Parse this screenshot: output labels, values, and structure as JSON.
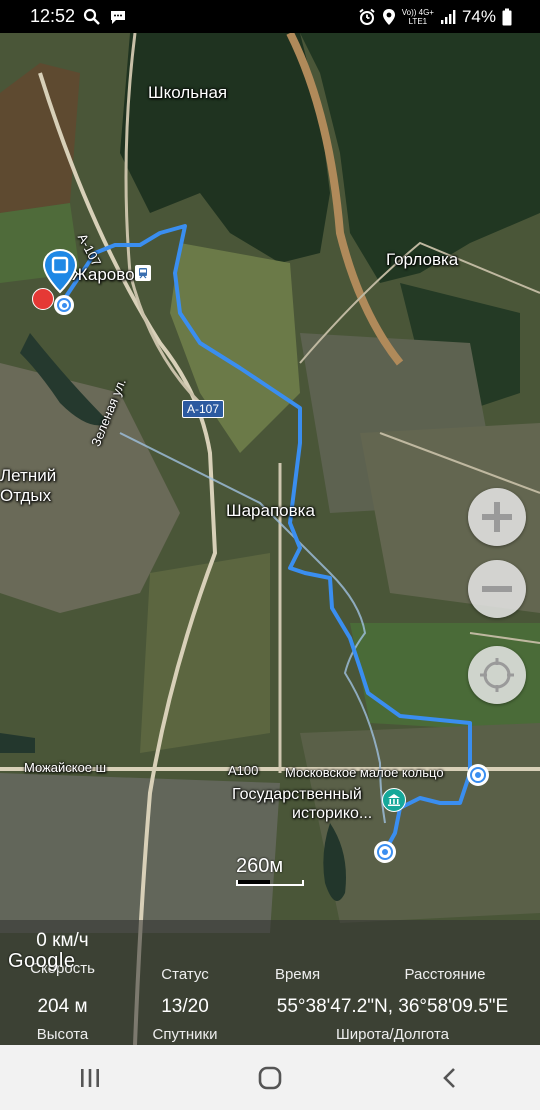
{
  "status_bar": {
    "time": "12:52",
    "network_top": "Vo)) 4G+",
    "network_bottom": "LTE1",
    "battery": "74%",
    "icons": [
      "search-icon",
      "message-icon",
      "alarm-icon",
      "location-icon",
      "signal-icon",
      "battery-icon"
    ]
  },
  "map": {
    "places": {
      "shkolnaya": "Школьная",
      "gorlovka": "Горловка",
      "zharovo": "Жарово",
      "letniy": "Летний",
      "otdykh": "Отдых",
      "sharapovka": "Шараповка",
      "museum_line1": "Государственный",
      "museum_line2": "историко..."
    },
    "roads": {
      "a107_top": "А-107",
      "a107_mid": "А-107",
      "a100": "А100",
      "zelenaya": "Зеленая ул.",
      "mozhayskoe": "Можайское ш",
      "ring": "Московское малое кольцо"
    },
    "scale_label": "260м",
    "zoom_in": "+",
    "zoom_out": "−",
    "attribution": "Google",
    "track_color": "#3a8ef0"
  },
  "info": {
    "speed": "0 км/ч",
    "speed_label": "Скорость",
    "status_label": "Статус",
    "time_label": "Время",
    "distance_label": "Расстояние",
    "altitude": "204 м",
    "altitude_label": "Высота",
    "satellites": "13/20",
    "satellites_label": "Спутники",
    "coords": "55°38'47.2\"N, 36°58'09.5\"E",
    "coords_label": "Широта/Долгота"
  },
  "nav": {
    "icons": [
      "recent-apps-icon",
      "home-icon",
      "back-icon"
    ]
  }
}
